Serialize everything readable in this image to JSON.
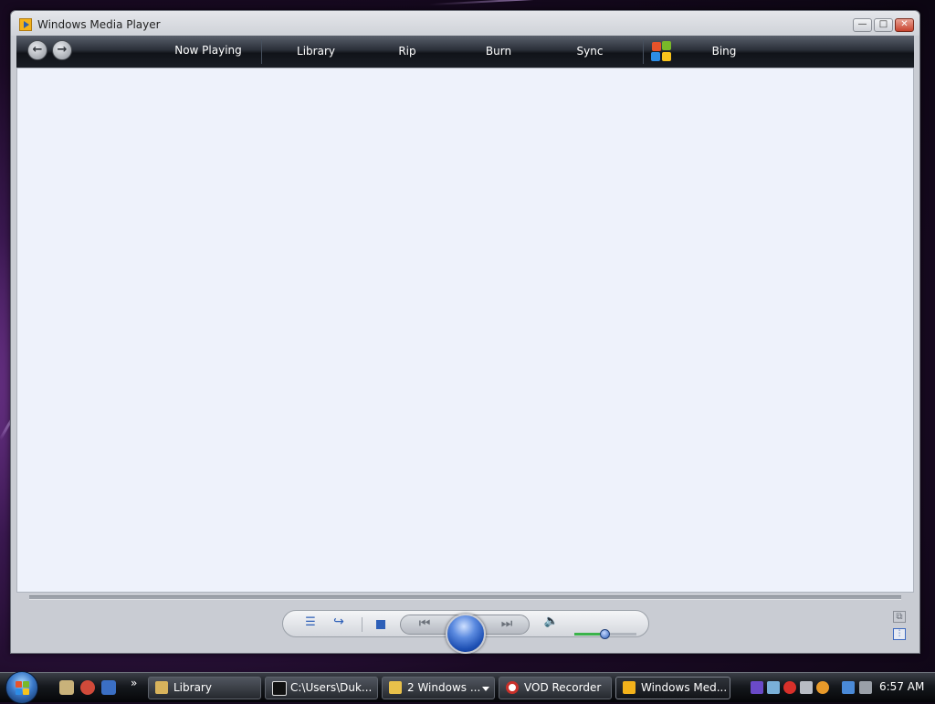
{
  "window": {
    "title": "Windows Media Player",
    "buttons": {
      "minimize": "—",
      "maximize": "□",
      "close": "✕"
    }
  },
  "navbar": {
    "back_icon": "back-arrow-icon",
    "forward_icon": "forward-arrow-icon",
    "tabs": [
      {
        "label": "Now Playing"
      },
      {
        "label": "Library"
      },
      {
        "label": "Rip"
      },
      {
        "label": "Burn"
      },
      {
        "label": "Sync"
      },
      {
        "label": "Bing"
      }
    ]
  },
  "controls": {
    "shuffle_icon": "☰",
    "repeat_icon": "↪",
    "previous_icon": "⏮",
    "next_icon": "⏭",
    "mute_icon": "🔈",
    "volume_fraction": 0.48
  },
  "side": {
    "switch_view_icon": "⧉",
    "compact_icon": "⫶"
  },
  "taskbar": {
    "quick_launch_more": "»",
    "tasks": [
      {
        "label": "Library",
        "icon": "folder-icon",
        "active": false
      },
      {
        "label": "C:\\Users\\Duk...",
        "icon": "7zip-icon",
        "active": false
      },
      {
        "label": "2 Windows ...",
        "icon": "explorer-icon",
        "active": false,
        "grouped": true
      },
      {
        "label": "VOD Recorder",
        "icon": "record-icon",
        "active": false
      },
      {
        "label": "Windows Med...",
        "icon": "media-player-icon",
        "active": true
      }
    ],
    "clock": "6:57 AM"
  },
  "colors": {
    "accent": "#2d5fb8",
    "content_bg": "#eef2fb",
    "navbar_dark": "#101319"
  }
}
